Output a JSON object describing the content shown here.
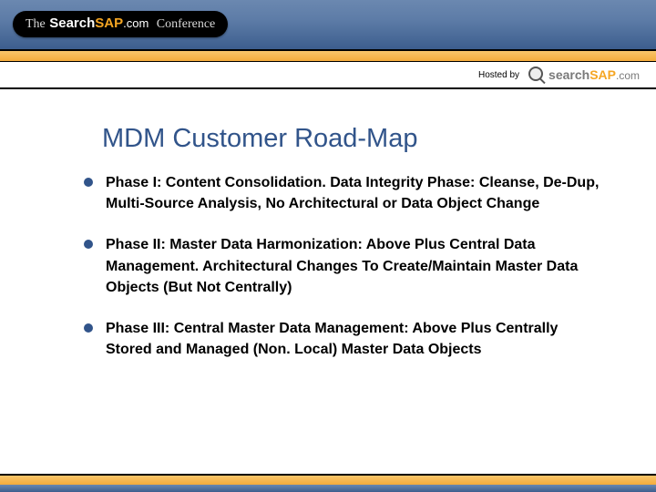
{
  "header": {
    "pill_prefix": "The",
    "brand_search": "Search",
    "brand_sap": "SAP",
    "brand_com": ".com",
    "pill_suffix": "Conference"
  },
  "hosted": {
    "label": "Hosted by",
    "logo_search": "search",
    "logo_sap": "SAP",
    "logo_com": ".com"
  },
  "title": "MDM Customer Road-Map",
  "bullets": [
    "Phase I: Content Consolidation. Data Integrity Phase: Cleanse, De-Dup, Multi-Source Analysis, No Architectural or Data Object Change",
    "Phase II: Master Data Harmonization: Above Plus Central Data Management. Architectural Changes To Create/Maintain Master Data Objects (But Not Centrally)",
    "Phase III: Central Master Data Management: Above Plus Centrally Stored and Managed (Non. Local) Master Data Objects"
  ]
}
